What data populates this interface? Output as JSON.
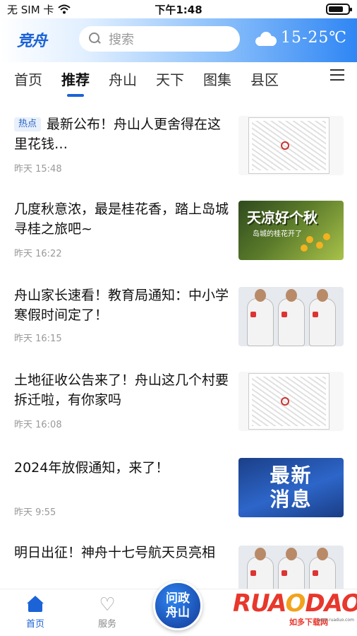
{
  "status_bar": {
    "carrier": "无 SIM 卡",
    "time": "下午1:48"
  },
  "header": {
    "logo_text": "竞舟",
    "search_placeholder": "搜索",
    "weather": "15-25℃"
  },
  "tabs": [
    {
      "label": "首页"
    },
    {
      "label": "推荐"
    },
    {
      "label": "舟山"
    },
    {
      "label": "天下"
    },
    {
      "label": "图集"
    },
    {
      "label": "县区"
    }
  ],
  "active_tab": "推荐",
  "feed": [
    {
      "badge": "热点",
      "title": "最新公布！舟山人更舍得在这里花钱…",
      "time": "昨天  15:48",
      "thumb": "map"
    },
    {
      "title": "几度秋意浓，最是桂花香，踏上岛城寻桂之旅吧~",
      "time": "昨天  16:22",
      "thumb": "autumn",
      "thumb_text": "天凉好个秋",
      "thumb_sub": "岛城的桂花开了"
    },
    {
      "title": "舟山家长速看！教育局通知：中小学寒假时间定了！",
      "time": "昨天  16:15",
      "thumb": "astronauts"
    },
    {
      "title": "土地征收公告来了！舟山这几个村要拆迁啦，有你家吗",
      "time": "昨天  16:08",
      "thumb": "map"
    },
    {
      "title": "2024年放假通知，来了！",
      "time": "昨天  9:55",
      "thumb": "news",
      "thumb_line1": "最新",
      "thumb_line2": "消息"
    },
    {
      "title": "明日出征！神舟十七号航天员亮相",
      "thumb": "astronauts"
    }
  ],
  "bottom_nav": {
    "home": "首页",
    "service": "服务",
    "center_line1": "问政",
    "center_line2": "舟山"
  },
  "watermark": {
    "logo_part1": "RUA",
    "logo_part2": "O",
    "logo_part3": "DAO",
    "sub": "如多下载网",
    "url": "www.ruaduo.com"
  },
  "colors": {
    "accent": "#1b63d6",
    "header_gradient_end": "#2f86f4",
    "watermark_red": "#e8372c"
  }
}
